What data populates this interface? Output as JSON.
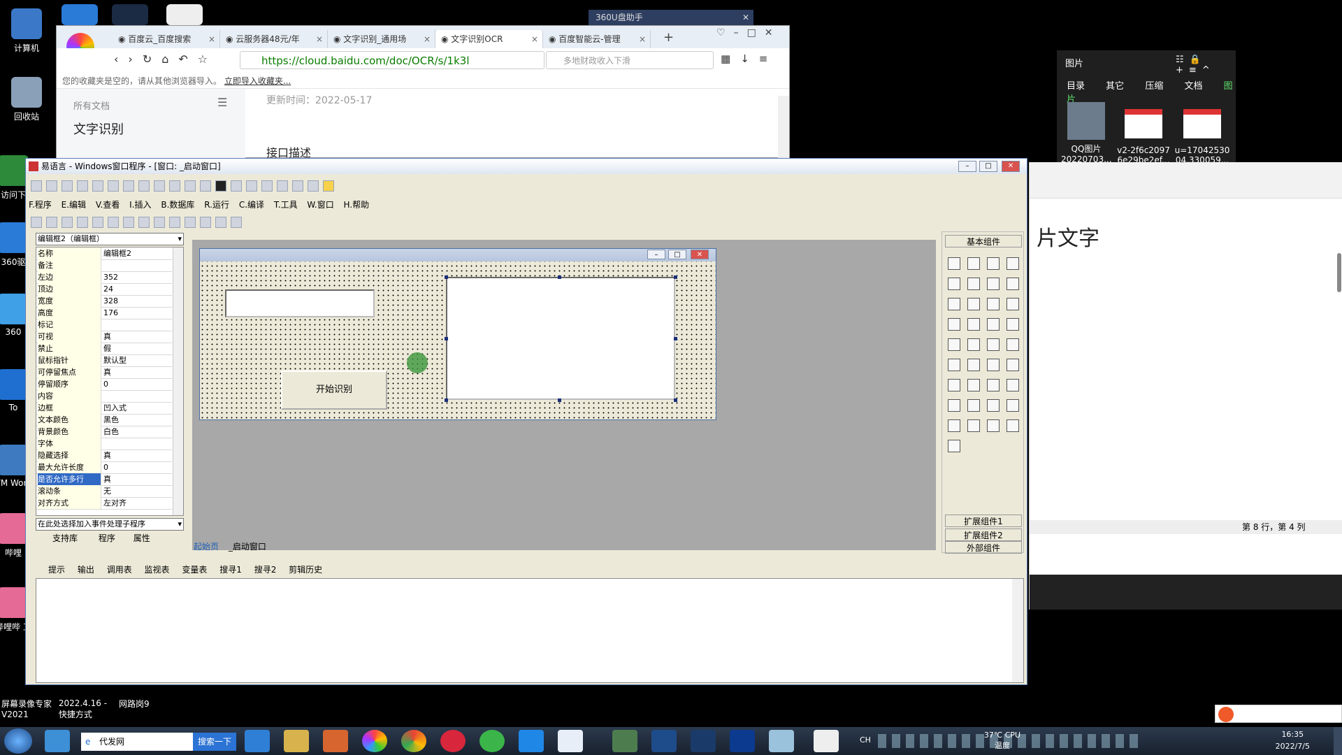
{
  "desktop": {
    "icons": [
      {
        "label": "计算机"
      },
      {
        "label": "回收站"
      },
      {
        "label": "访问下"
      },
      {
        "label": "360驱"
      },
      {
        "label": "360"
      },
      {
        "label": "To"
      },
      {
        "label": "VM Work"
      },
      {
        "label": "哔哩"
      },
      {
        "label": "哔哩哔 工"
      }
    ],
    "bottom_labels": [
      "屏幕录像专家 V2021",
      "2022.4.16 - 快捷方式",
      "网路岗9"
    ],
    "helper_title": "360U盘助手"
  },
  "browser": {
    "tabs": [
      {
        "label": "百度云_百度搜索"
      },
      {
        "label": "云服务器48元/年"
      },
      {
        "label": "文字识别_通用场"
      },
      {
        "label": "文字识别OCR"
      },
      {
        "label": "百度智能云-管理"
      }
    ],
    "url": "https://cloud.baidu.com/doc/OCR/s/1k3l",
    "search_placeholder": "多地财政收入下滑",
    "bookmark_bar": "您的收藏夹是空的，请从其他浏览器导入。",
    "bookmark_link": "立即导入收藏夹...",
    "sidebar_heading": "所有文档",
    "sidebar_title": "文字识别",
    "updated": "更新时间：2022-05-17",
    "section": "接口描述"
  },
  "right_panel": {
    "title": "图片",
    "tabs": [
      "目录",
      "其它",
      "压缩",
      "文档",
      "图片"
    ],
    "files": [
      {
        "name": "QQ图片 20220703..."
      },
      {
        "name": "v2-2f6c2097 6e29be2ef..."
      },
      {
        "name": "u=17042530 04,330059..."
      }
    ],
    "doc_text": "片文字",
    "status": "第 8 行，第 4 列"
  },
  "ide": {
    "title": "易语言 - Windows窗口程序 - [窗口: _启动窗口]",
    "menus": [
      "F.程序",
      "E.编辑",
      "V.查看",
      "I.插入",
      "B.数据库",
      "R.运行",
      "C.编译",
      "T.工具",
      "W.窗口",
      "H.帮助"
    ],
    "object_selector": "编辑框2（编辑框）",
    "properties": [
      {
        "k": "名称",
        "v": "编辑框2"
      },
      {
        "k": "备注",
        "v": ""
      },
      {
        "k": "左边",
        "v": "352"
      },
      {
        "k": "顶边",
        "v": "24"
      },
      {
        "k": "宽度",
        "v": "328"
      },
      {
        "k": "高度",
        "v": "176"
      },
      {
        "k": "标记",
        "v": ""
      },
      {
        "k": "可视",
        "v": "真"
      },
      {
        "k": "禁止",
        "v": "假"
      },
      {
        "k": "鼠标指针",
        "v": "默认型"
      },
      {
        "k": "可停留焦点",
        "v": "真"
      },
      {
        "k": "停留顺序",
        "v": "0"
      },
      {
        "k": "内容",
        "v": ""
      },
      {
        "k": "边框",
        "v": "凹入式"
      },
      {
        "k": "文本颜色",
        "v": "黑色"
      },
      {
        "k": "背景颜色",
        "v": "白色"
      },
      {
        "k": "字体",
        "v": ""
      },
      {
        "k": "隐藏选择",
        "v": "真"
      },
      {
        "k": "最大允许长度",
        "v": "0"
      },
      {
        "k": "是否允许多行",
        "v": "真"
      },
      {
        "k": "滚动条",
        "v": "无"
      },
      {
        "k": "对齐方式",
        "v": "左对齐"
      }
    ],
    "event_selector": "在此处选择加入事件处理子程序",
    "left_tabs": [
      "支持库",
      "程序",
      "属性"
    ],
    "design_tabs": [
      "起始页",
      "_启动窗口"
    ],
    "button_label": "开始识别",
    "toolbox_title": "基本组件",
    "toolbox_groups": [
      "扩展组件1",
      "扩展组件2",
      "外部组件"
    ],
    "bottom_tabs": [
      "提示",
      "输出",
      "调用表",
      "监视表",
      "变量表",
      "搜寻1",
      "搜寻2",
      "剪辑历史"
    ]
  },
  "taskbar": {
    "search_text": "代发网",
    "search_button": "搜索一下",
    "temp": "37℃ CPU温度",
    "time": "16:35",
    "date": "2022/7/5",
    "ime": "CH"
  }
}
